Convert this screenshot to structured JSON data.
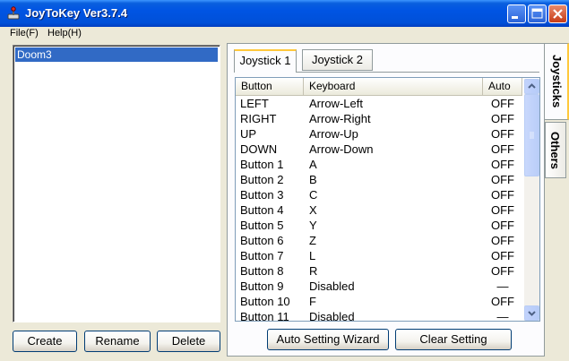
{
  "window": {
    "title": "JoyToKey Ver3.7.4",
    "icon": "joystick-app-icon",
    "controls": [
      "minimize-icon",
      "maximize-icon",
      "close-icon"
    ]
  },
  "menu": {
    "file": "File(F)",
    "help": "Help(H)"
  },
  "profiles": {
    "items": [
      "Doom3"
    ],
    "selected": "Doom3"
  },
  "profile_buttons": {
    "create": "Create",
    "rename": "Rename",
    "delete": "Delete"
  },
  "tabs": {
    "joystick1": "Joystick 1",
    "joystick2": "Joystick 2",
    "active": "Joystick 1"
  },
  "side_tabs": {
    "joysticks": "Joysticks",
    "others": "Others"
  },
  "grid": {
    "headers": {
      "button": "Button",
      "keyboard": "Keyboard",
      "auto": "Auto"
    },
    "rows": [
      {
        "button": "LEFT",
        "keyboard": "Arrow-Left",
        "auto": "OFF"
      },
      {
        "button": "RIGHT",
        "keyboard": "Arrow-Right",
        "auto": "OFF"
      },
      {
        "button": "UP",
        "keyboard": "Arrow-Up",
        "auto": "OFF"
      },
      {
        "button": "DOWN",
        "keyboard": "Arrow-Down",
        "auto": "OFF"
      },
      {
        "button": "Button 1",
        "keyboard": "A",
        "auto": "OFF"
      },
      {
        "button": "Button 2",
        "keyboard": "B",
        "auto": "OFF"
      },
      {
        "button": "Button 3",
        "keyboard": "C",
        "auto": "OFF"
      },
      {
        "button": "Button 4",
        "keyboard": "X",
        "auto": "OFF"
      },
      {
        "button": "Button 5",
        "keyboard": "Y",
        "auto": "OFF"
      },
      {
        "button": "Button 6",
        "keyboard": "Z",
        "auto": "OFF"
      },
      {
        "button": "Button 7",
        "keyboard": "L",
        "auto": "OFF"
      },
      {
        "button": "Button 8",
        "keyboard": "R",
        "auto": "OFF"
      },
      {
        "button": "Button 9",
        "keyboard": "Disabled",
        "auto": "—"
      },
      {
        "button": "Button 10",
        "keyboard": "F",
        "auto": "OFF"
      },
      {
        "button": "Button 11",
        "keyboard": "Disabled",
        "auto": "—"
      }
    ]
  },
  "action_buttons": {
    "wizard": "Auto Setting Wizard",
    "clear": "Clear Setting"
  },
  "colors": {
    "titlebar": "#0054e3",
    "selection": "#316ac5",
    "window_bg": "#ece9d8",
    "tab_highlight": "#ffc83c"
  }
}
